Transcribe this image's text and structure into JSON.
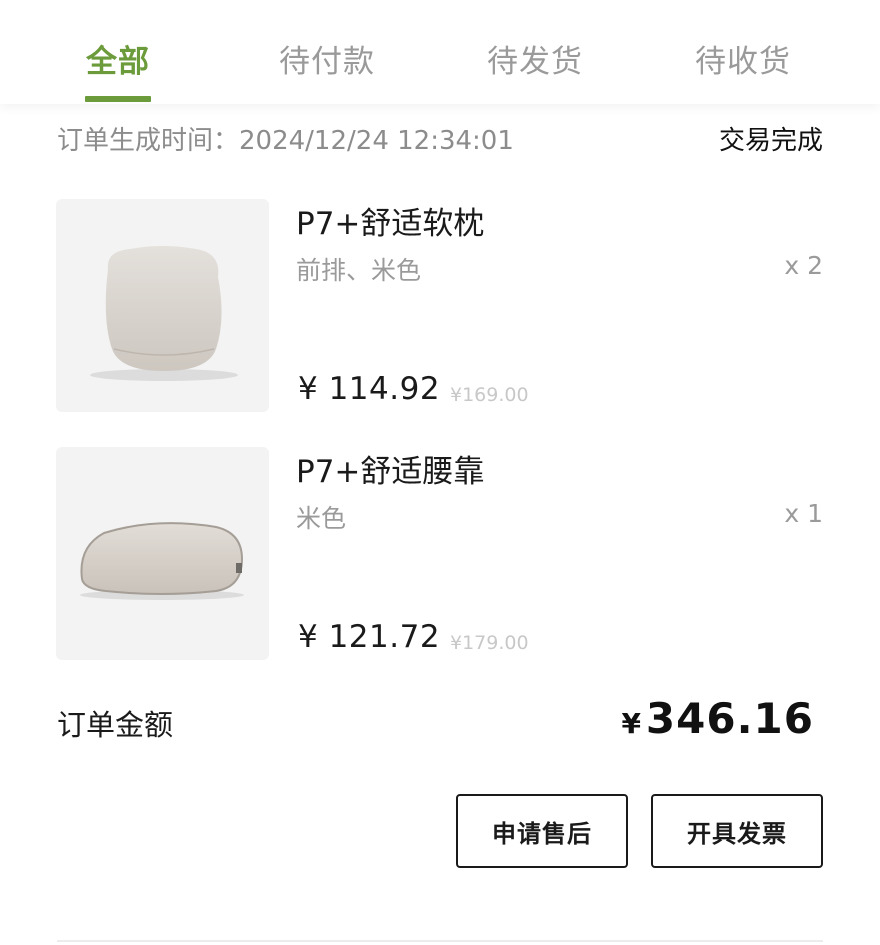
{
  "tabs": [
    {
      "label": "全部",
      "active": true
    },
    {
      "label": "待付款",
      "active": false
    },
    {
      "label": "待发货",
      "active": false
    },
    {
      "label": "待收货",
      "active": false
    }
  ],
  "order": {
    "time_label": "订单生成时间：2024/12/24 12:34:01",
    "status": "交易完成",
    "items": [
      {
        "title": "P7+舒适软枕",
        "spec": "前排、米色",
        "qty": "x 2",
        "price": "¥ 114.92",
        "original_price": "¥169.00",
        "icon": "headrest-pillow-image"
      },
      {
        "title": "P7+舒适腰靠",
        "spec": "米色",
        "qty": "x 1",
        "price": "¥ 121.72",
        "original_price": "¥179.00",
        "icon": "lumbar-pillow-image"
      }
    ],
    "total_label": "订单金额",
    "total_currency": "¥",
    "total_amount": "346.16"
  },
  "actions": {
    "after_sales": "申请售后",
    "invoice": "开具发票"
  },
  "colors": {
    "accent": "#6b9b3a",
    "muted": "#9a9a9a",
    "text": "#1a1a1a"
  }
}
